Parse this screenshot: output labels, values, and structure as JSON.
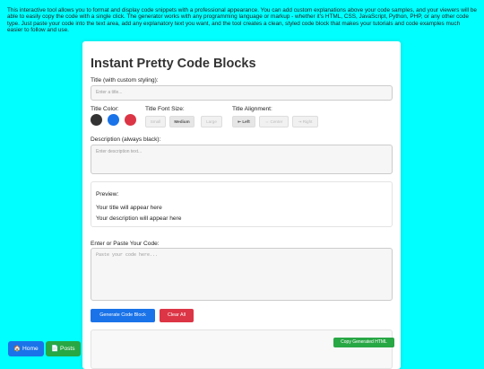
{
  "intro_text": "This interactive tool allows you to format and display code snippets with a professional appearance. You can add custom explanations above your code samples, and your viewers will be able to easily copy the code with a single click. The generator works with any programming language or markup - whether it's HTML, CSS, JavaScript, Python, PHP, or any other code type. Just paste your code into the text area, add any explanatory text you want, and the tool creates a clean, styled code block that makes your tutorials and code examples much easier to follow and use.",
  "app": {
    "title": "Instant Pretty Code Blocks"
  },
  "title_field": {
    "label": "Title (with custom styling):",
    "placeholder": "Enter a title..."
  },
  "title_color": {
    "label": "Title Color:",
    "swatches": [
      {
        "name": "dark",
        "color": "#333333"
      },
      {
        "name": "blue",
        "color": "#1a73e8"
      },
      {
        "name": "red",
        "color": "#dc3545"
      }
    ]
  },
  "font_size": {
    "label": "Title Font Size:",
    "options": [
      "Small",
      "Medium",
      "Large"
    ],
    "selected": "Medium"
  },
  "alignment": {
    "label": "Title Alignment:",
    "options": [
      "⇤ Left",
      "⇔ Center",
      "⇥ Right"
    ],
    "selected": "⇤ Left"
  },
  "description_field": {
    "label": "Description (always black):",
    "placeholder": "Enter description text..."
  },
  "preview": {
    "heading": "Preview:",
    "title_text": "Your title will appear here",
    "description_text": "Your description will appear here"
  },
  "code_field": {
    "label": "Enter or Paste Your Code:",
    "placeholder": "Paste your code here..."
  },
  "buttons": {
    "generate": "Generate Code Block",
    "clear": "Clear All",
    "copy": "Copy Generated HTML"
  },
  "nav": {
    "home": "🏠 Home",
    "posts": "📄 Posts"
  },
  "colors": {
    "accent": "#1a73e8",
    "danger": "#dc3545",
    "success": "#28a745",
    "background": "#00ffff"
  }
}
